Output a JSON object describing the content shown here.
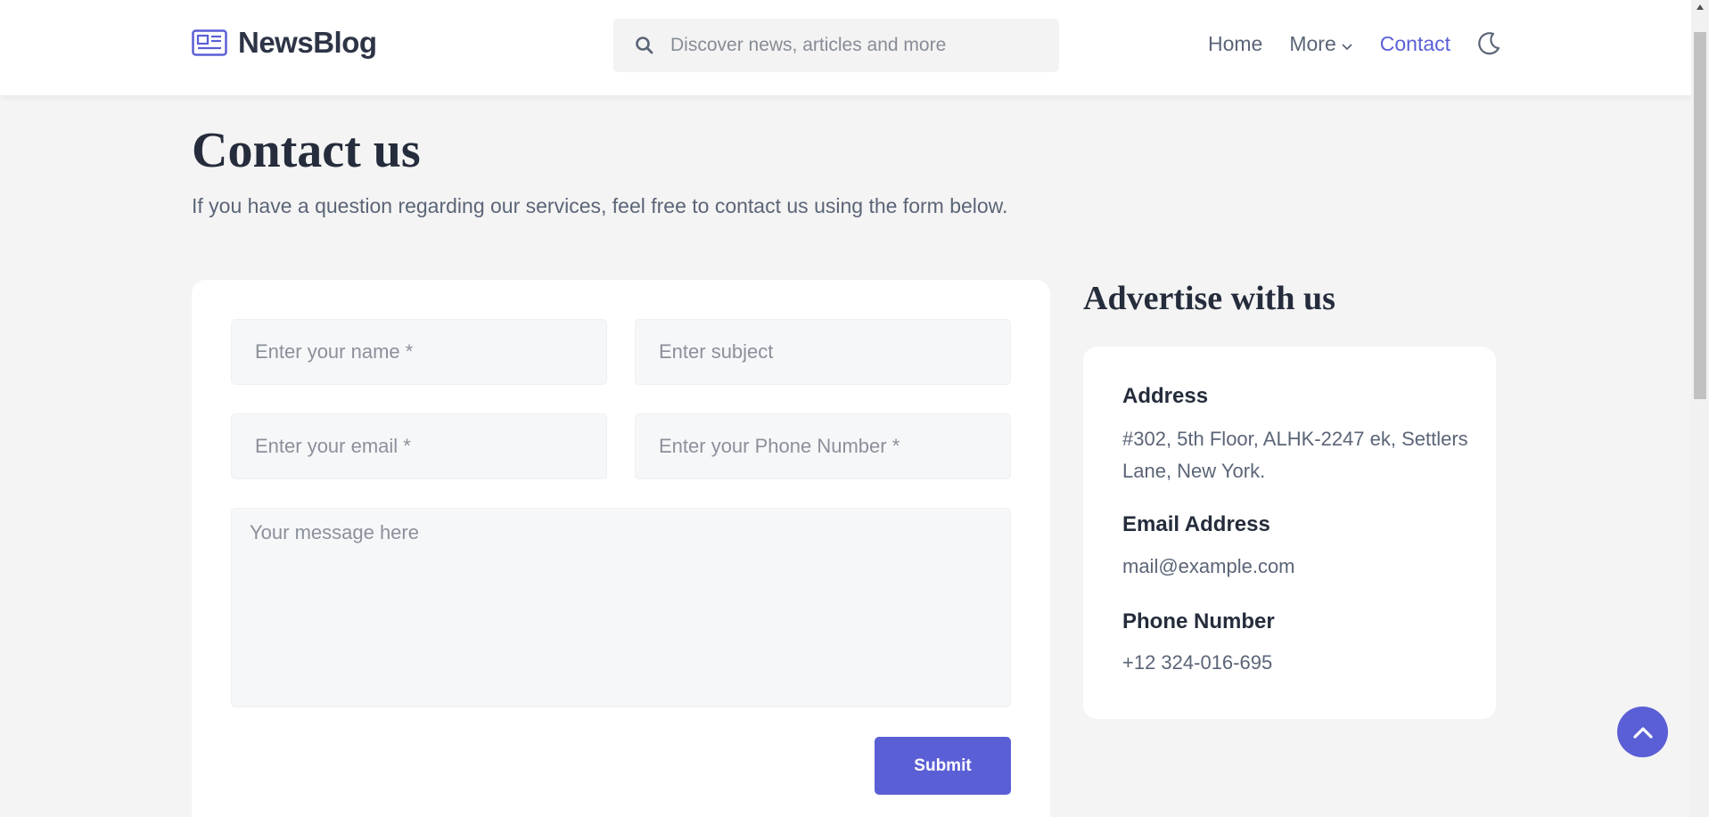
{
  "header": {
    "brand_name": "NewsBlog",
    "search_placeholder": "Discover news, articles and more",
    "nav": {
      "home": "Home",
      "more": "More",
      "contact": "Contact"
    }
  },
  "page": {
    "title": "Contact us",
    "subtitle": "If you have a question regarding our services, feel free to contact us using the form below."
  },
  "form": {
    "name_placeholder": "Enter your name *",
    "subject_placeholder": "Enter subject",
    "email_placeholder": "Enter your email *",
    "phone_placeholder": "Enter your Phone Number *",
    "message_placeholder": "Your message here",
    "submit_label": "Submit"
  },
  "sidebar": {
    "title": "Advertise with us",
    "address_label": "Address",
    "address_value": "#302, 5th Floor, ALHK-2247 ek, Settlers Lane, New York.",
    "email_label": "Email Address",
    "email_value": "mail@example.com",
    "phone_label": "Phone Number",
    "phone_value": "+12 324-016-695"
  },
  "icons": {
    "brand": "newspaper-icon",
    "search": "search-icon",
    "more": "chevron-down-icon",
    "theme": "moon-icon",
    "to_top": "chevron-up-icon"
  },
  "colors": {
    "accent": "#5b5fd6",
    "background": "#f4f4f4",
    "heading": "#252c3b",
    "muted_text": "#5b6577"
  }
}
